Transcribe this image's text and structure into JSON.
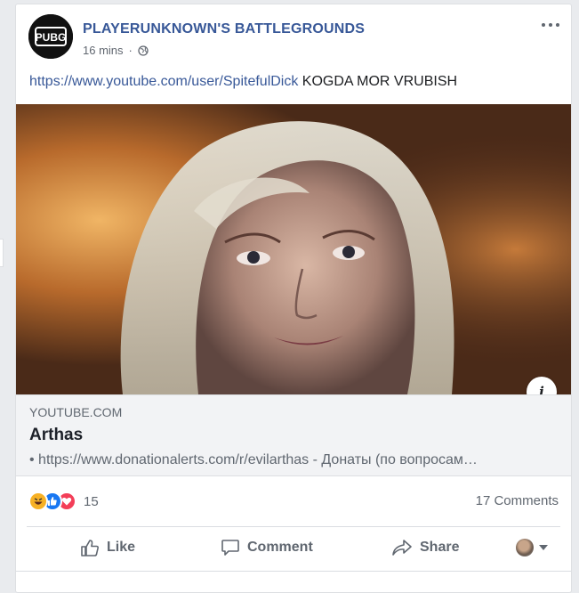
{
  "post": {
    "page_name": "PLAYERUNKNOWN'S BATTLEGROUNDS",
    "avatar_text": "PUBG",
    "time": "16 mins",
    "separator": "·",
    "privacy_icon": "globe-icon",
    "more_icon": "more-dots-icon",
    "text_link": "https://www.youtube.com/user/SpitefulDick",
    "text_rest": " KOGDA MOR VRUBISH"
  },
  "link_preview": {
    "info_label": "i",
    "domain": "YOUTUBE.COM",
    "title": "Arthas",
    "description": "• https://www.donationalerts.com/r/evilarthas - Донаты (по вопросам…"
  },
  "stats": {
    "reaction_icons": [
      "haha-icon",
      "like-icon",
      "love-icon"
    ],
    "reaction_count": "15",
    "comments": "17 Comments"
  },
  "actions": {
    "like": "Like",
    "comment": "Comment",
    "share": "Share"
  },
  "colors": {
    "link": "#385898",
    "like_blue": "#1877f2",
    "love_red": "#f33e58",
    "haha_yellow": "#f7b125"
  }
}
